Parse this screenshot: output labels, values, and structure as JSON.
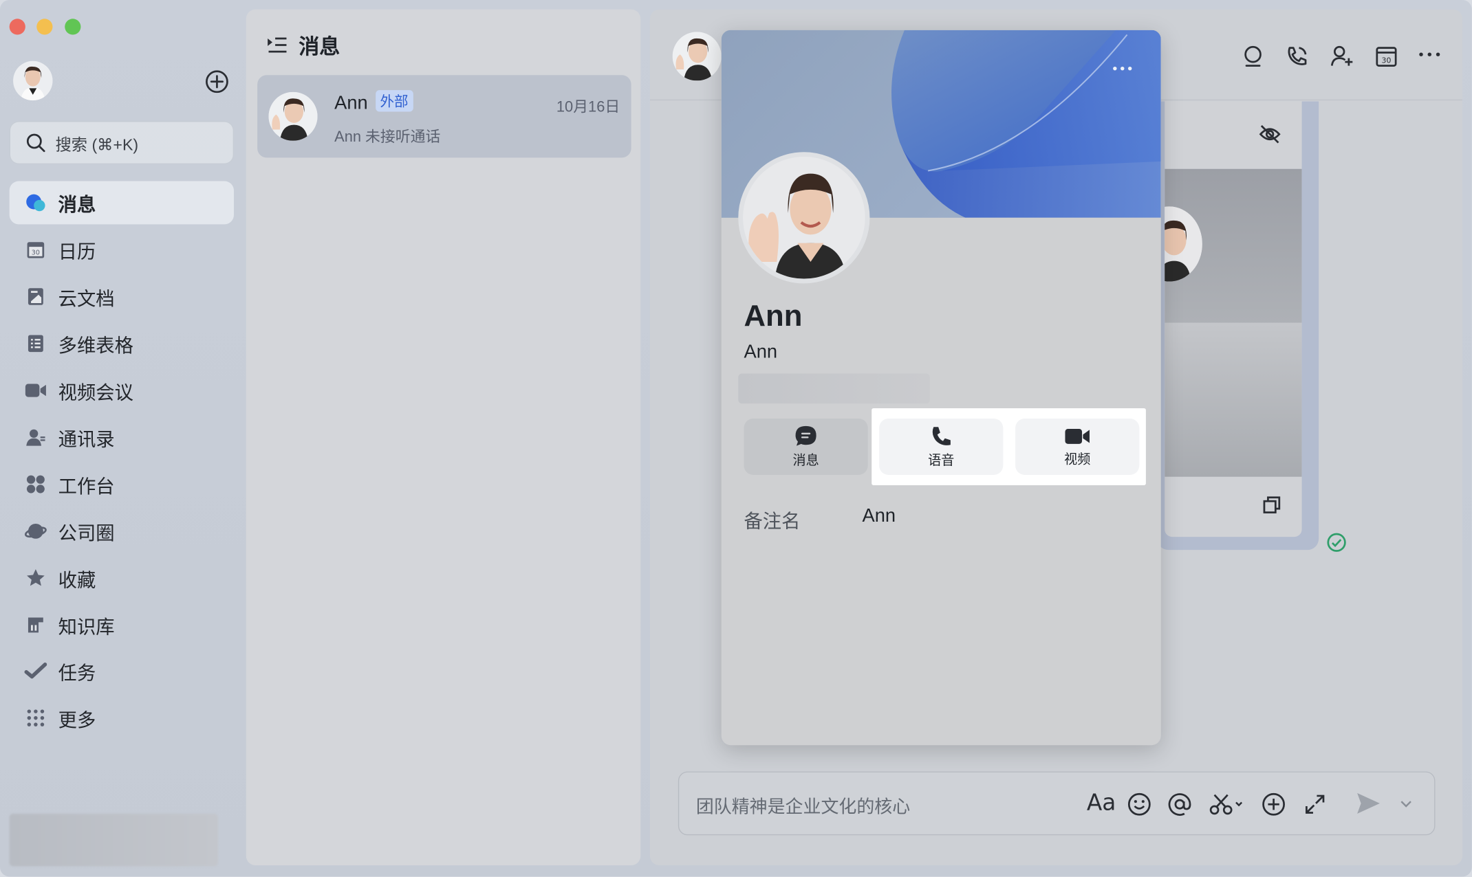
{
  "sidebar": {
    "search_placeholder": "搜索 (⌘+K)",
    "items": [
      {
        "label": "消息",
        "icon": "message-icon",
        "active": true
      },
      {
        "label": "日历",
        "icon": "calendar-icon",
        "active": false
      },
      {
        "label": "云文档",
        "icon": "docs-icon",
        "active": false
      },
      {
        "label": "多维表格",
        "icon": "base-table-icon",
        "active": false
      },
      {
        "label": "视频会议",
        "icon": "video-meeting-icon",
        "active": false
      },
      {
        "label": "通讯录",
        "icon": "contacts-icon",
        "active": false
      },
      {
        "label": "工作台",
        "icon": "workplace-icon",
        "active": false
      },
      {
        "label": "公司圈",
        "icon": "moments-icon",
        "active": false
      },
      {
        "label": "收藏",
        "icon": "star-icon",
        "active": false
      },
      {
        "label": "知识库",
        "icon": "wiki-icon",
        "active": false
      },
      {
        "label": "任务",
        "icon": "task-icon",
        "active": false
      },
      {
        "label": "更多",
        "icon": "more-grid-icon",
        "active": false
      }
    ]
  },
  "list": {
    "title": "消息",
    "chats": [
      {
        "name": "Ann",
        "badge": "外部",
        "date": "10月16日",
        "preview": "Ann 未接听通话"
      }
    ]
  },
  "profile": {
    "name": "Ann",
    "subname": "Ann",
    "actions": {
      "message": "消息",
      "voice": "语音",
      "video": "视频"
    },
    "remark_label": "备注名",
    "remark_value": "Ann"
  },
  "chat": {
    "input_placeholder": "团队精神是企业文化的核心",
    "font_button": "Aa"
  },
  "colors": {
    "accent": "#2f5fd0",
    "active_nav_icon": "#2d6ae3",
    "success_check": "#2f9e6a"
  }
}
